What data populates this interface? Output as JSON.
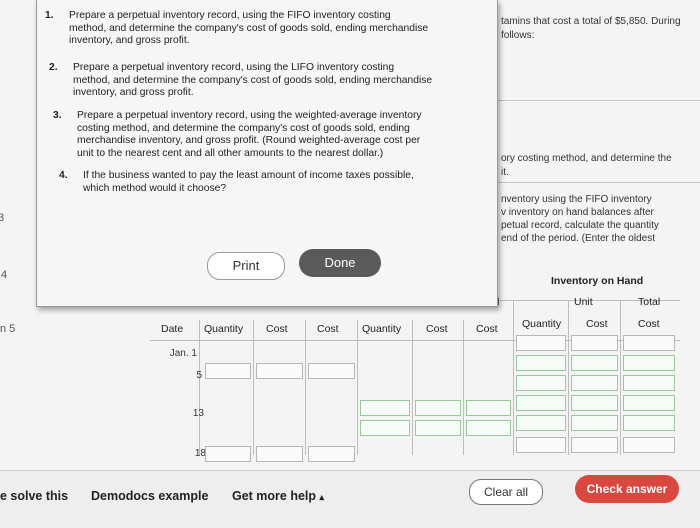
{
  "background": {
    "right_text_1": "tamins that cost a total of $5,850. During",
    "right_text_2": "follows:",
    "right_text_3": "ory costing method, and determine the",
    "right_text_4": "it.",
    "right_text_5": "nventory using the FIFO inventory",
    "right_text_6": "v inventory on hand balances after",
    "right_text_7": "petual record, calculate the quantity",
    "right_text_8": "end of the period. (Enter the oldest",
    "edge_3": "3",
    "edge_4": "4",
    "edge_5": "n 5"
  },
  "popup": {
    "items": [
      {
        "num": "1.",
        "text": "Prepare a perpetual inventory record, using the FIFO inventory costing method, and determine the company's cost of goods sold, ending merchandise inventory, and gross profit."
      },
      {
        "num": "2.",
        "text": "Prepare a perpetual inventory record, using the LIFO inventory costing method, and determine the company's cost of goods sold, ending merchandise inventory, and gross profit."
      },
      {
        "num": "3.",
        "text": "Prepare a perpetual inventory record, using the weighted-average inventory costing method, and determine the company's cost of goods sold, ending merchandise inventory, and gross profit. (Round weighted-average cost per unit to the nearest cent and all other amounts to the nearest dollar.)"
      },
      {
        "num": "4.",
        "text": "If the business wanted to pay the least amount of income taxes possible, which method would it choose?"
      }
    ],
    "print_label": "Print",
    "done_label": "Done"
  },
  "table": {
    "inventory_on_hand": "Inventory on Hand",
    "total_cost_partial": "l",
    "headers": {
      "date": "Date",
      "quantity1": "Quantity",
      "cost1": "Cost",
      "cost2": "Cost",
      "quantity2": "Quantity",
      "cost3": "Cost",
      "cost4": "Cost",
      "quantity3": "Quantity",
      "unit": "Unit",
      "unit_cost": "Cost",
      "total": "Total",
      "total_cost": "Cost"
    },
    "rows": [
      {
        "date": "Jan. 1",
        "qty": ""
      },
      {
        "date": "",
        "qty": "5"
      },
      {
        "date": "",
        "qty": "13"
      },
      {
        "date": "",
        "qty": "18"
      }
    ]
  },
  "bottom": {
    "solve_label": "e solve this",
    "demodocs_label": "Demodocs example",
    "help_label": "Get more help",
    "help_caret": "▴",
    "clear_label": "Clear all",
    "check_label": "Check answer"
  }
}
